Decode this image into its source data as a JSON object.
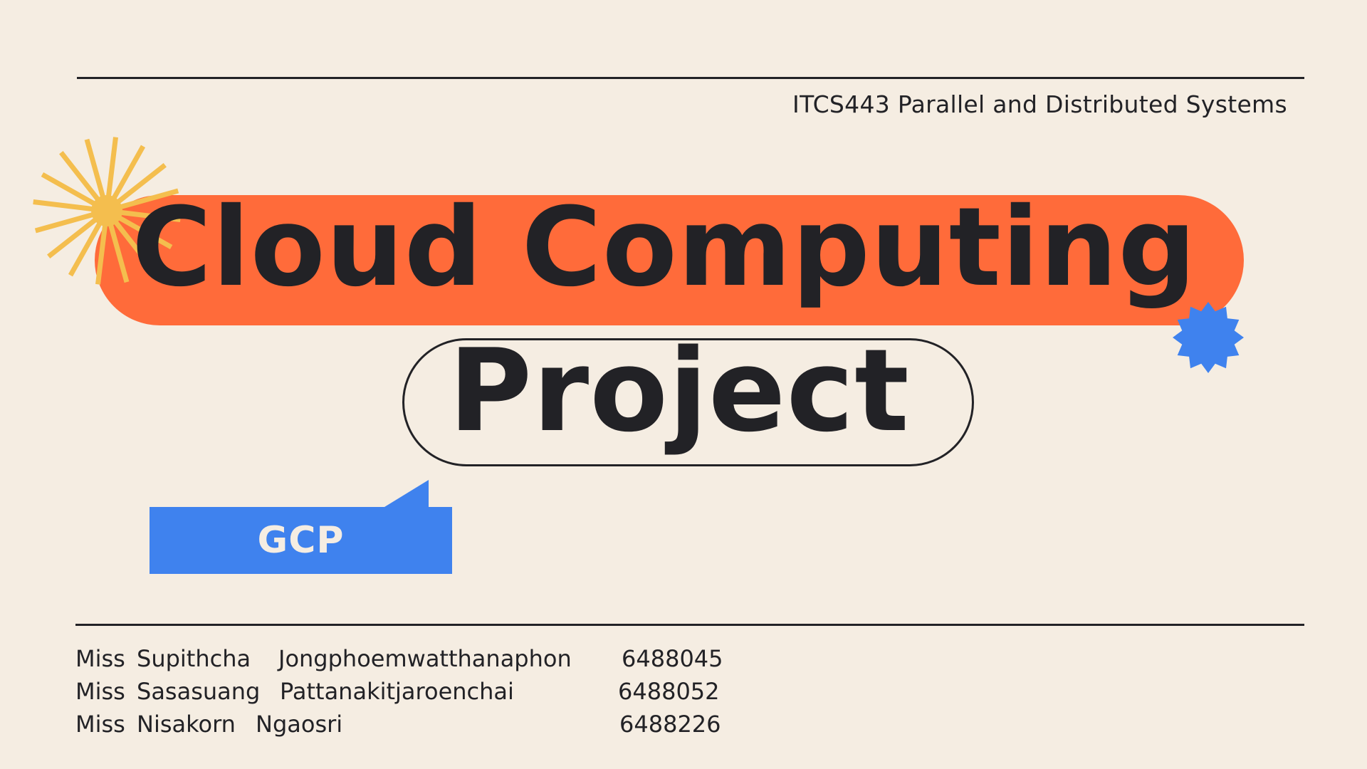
{
  "slide": {
    "course": "ITCS443 Parallel and Distributed Systems",
    "title_line1": "Cloud Computing",
    "title_line2": "Project",
    "tag": "GCP",
    "members": [
      {
        "prefix": "Miss",
        "first": "Supithcha",
        "last": "Jongphoemwatthanaphon",
        "id": "6488045"
      },
      {
        "prefix": "Miss",
        "first": "Sasasuang",
        "last": "Pattanakitjaroenchai",
        "id": "6488052"
      },
      {
        "prefix": "Miss",
        "first": "Nisakorn",
        "last": "Ngaosri",
        "id": "6488226"
      }
    ]
  },
  "colors": {
    "background": "#F5EDE2",
    "text": "#222226",
    "accent_orange": "#FF6B3A",
    "accent_blue": "#3F82EE",
    "accent_yellow": "#F4BE4E"
  },
  "icons": [
    "sunburst-icon",
    "star-badge-icon"
  ]
}
